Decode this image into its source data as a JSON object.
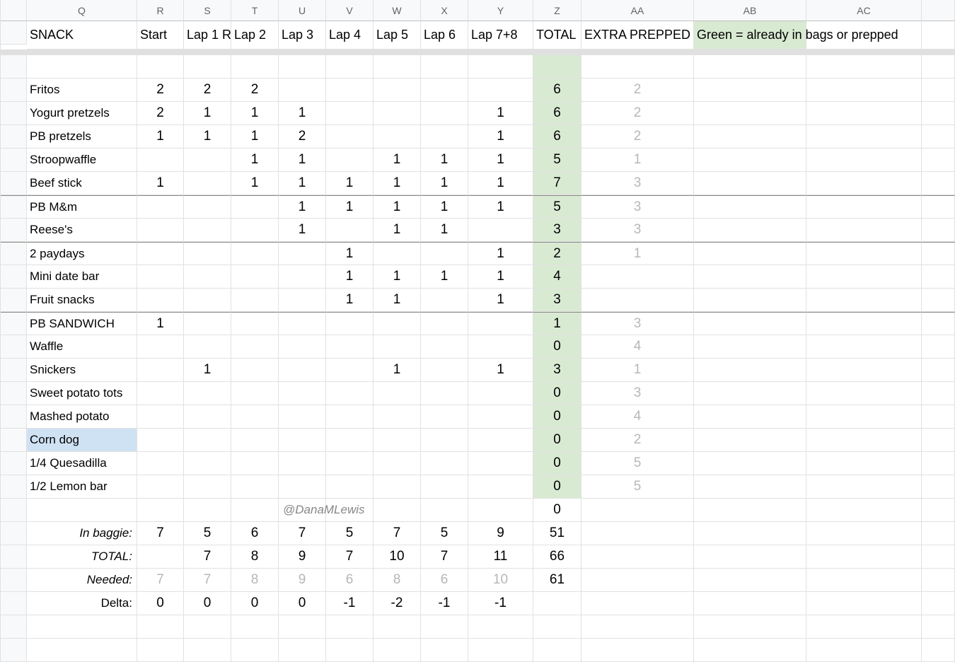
{
  "columns": [
    "",
    "Q",
    "R",
    "S",
    "T",
    "U",
    "V",
    "W",
    "X",
    "Y",
    "Z",
    "AA",
    "AB",
    "AC",
    ""
  ],
  "headers": [
    "SNACK",
    "Start",
    "Lap 1 R",
    "Lap 2",
    "Lap 3",
    "Lap 4",
    "Lap 5",
    "Lap 6",
    "Lap 7+8",
    "TOTAL",
    "EXTRA PREPPED"
  ],
  "legend": "Green = already in bags or prepped",
  "annotation": "@DanaMLewis",
  "rows": [
    {
      "name": "Fritos",
      "v": [
        "2",
        "2",
        "2",
        "",
        "",
        "",
        "",
        "",
        ""
      ],
      "total": "6",
      "extra": "2",
      "hthick": false
    },
    {
      "name": "Yogurt pretzels",
      "v": [
        "2",
        "1",
        "1",
        "1",
        "",
        "",
        "",
        "1",
        ""
      ],
      "total": "6",
      "extra": "2"
    },
    {
      "name": "PB pretzels",
      "v": [
        "1",
        "1",
        "1",
        "2",
        "",
        "",
        "",
        "1",
        ""
      ],
      "total": "6",
      "extra": "2"
    },
    {
      "name": "Stroopwaffle",
      "v": [
        "",
        "",
        "1",
        "1",
        "",
        "1",
        "1",
        "1",
        ""
      ],
      "total": "5",
      "extra": "1"
    },
    {
      "name": "Beef stick",
      "v": [
        "1",
        "",
        "1",
        "1",
        "1",
        "1",
        "1",
        "1",
        ""
      ],
      "total": "7",
      "extra": "3"
    },
    {
      "name": "PB M&m",
      "v": [
        "",
        "",
        "",
        "1",
        "1",
        "1",
        "1",
        "1",
        ""
      ],
      "total": "5",
      "extra": "3",
      "hthick": true
    },
    {
      "name": "Reese's",
      "v": [
        "",
        "",
        "",
        "1",
        "",
        "1",
        "1",
        "",
        ""
      ],
      "total": "3",
      "extra": "3"
    },
    {
      "name": "2 paydays",
      "v": [
        "",
        "",
        "",
        "",
        "1",
        "",
        "",
        "1",
        ""
      ],
      "total": "2",
      "extra": "1",
      "hthick": true
    },
    {
      "name": "Mini date bar",
      "v": [
        "",
        "",
        "",
        "",
        "1",
        "1",
        "1",
        "1",
        ""
      ],
      "total": "4",
      "extra": ""
    },
    {
      "name": "Fruit snacks",
      "v": [
        "",
        "",
        "",
        "",
        "1",
        "1",
        "",
        "1",
        ""
      ],
      "total": "3",
      "extra": ""
    },
    {
      "name": "PB SANDWICH",
      "v": [
        "1",
        "",
        "",
        "",
        "",
        "",
        "",
        "",
        ""
      ],
      "total": "1",
      "extra": "3",
      "hthick": true
    },
    {
      "name": "Waffle",
      "v": [
        "",
        "",
        "",
        "",
        "",
        "",
        "",
        "",
        ""
      ],
      "total": "0",
      "extra": "4"
    },
    {
      "name": "Snickers",
      "v": [
        "",
        "1",
        "",
        "",
        "",
        "1",
        "",
        "1",
        ""
      ],
      "total": "3",
      "extra": "1"
    },
    {
      "name": "Sweet potato tots",
      "v": [
        "",
        "",
        "",
        "",
        "",
        "",
        "",
        "",
        ""
      ],
      "total": "0",
      "extra": "3"
    },
    {
      "name": "Mashed potato",
      "v": [
        "",
        "",
        "",
        "",
        "",
        "",
        "",
        "",
        ""
      ],
      "total": "0",
      "extra": "4"
    },
    {
      "name": "Corn dog",
      "v": [
        "",
        "",
        "",
        "",
        "",
        "",
        "",
        "",
        ""
      ],
      "total": "0",
      "extra": "2",
      "blue": true
    },
    {
      "name": "1/4 Quesadilla",
      "v": [
        "",
        "",
        "",
        "",
        "",
        "",
        "",
        "",
        ""
      ],
      "total": "0",
      "extra": "5"
    },
    {
      "name": "1/2 Lemon bar",
      "v": [
        "",
        "",
        "",
        "",
        "",
        "",
        "",
        "",
        ""
      ],
      "total": "0",
      "extra": "5"
    }
  ],
  "sumrow": {
    "total": "0"
  },
  "footer": [
    {
      "label": "In baggie:",
      "v": [
        "7",
        "5",
        "6",
        "7",
        "5",
        "7",
        "5",
        "9"
      ],
      "total": "51",
      "italic": true
    },
    {
      "label": "TOTAL:",
      "v": [
        "",
        "7",
        "8",
        "9",
        "7",
        "10",
        "7",
        "11"
      ],
      "total": "66",
      "italic": true
    },
    {
      "label": "Needed:",
      "v": [
        "7",
        "7",
        "8",
        "9",
        "6",
        "8",
        "6",
        "10"
      ],
      "total": "61",
      "italic": true,
      "faded": true
    },
    {
      "label": "Delta:",
      "v": [
        "0",
        "0",
        "0",
        "0",
        "-1",
        "-2",
        "-1",
        "-1"
      ],
      "total": "",
      "italic": false
    }
  ]
}
